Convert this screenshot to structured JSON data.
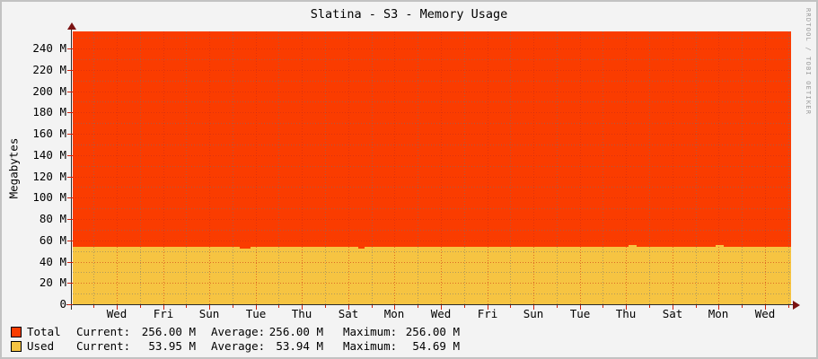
{
  "title": "Slatina - S3 - Memory Usage",
  "watermark": "RRDTOOL / TOBI OETIKER",
  "colors": {
    "total_area": "#FA3C00",
    "used_area": "#F6C442",
    "grid_minor": "#737373",
    "grid_major": "#CD2D14",
    "axis": "#2B2B2B",
    "arrow": "#7A1212",
    "tick": "#CC1F0A",
    "background": "#F3F3F3",
    "border": "#C2C2C2",
    "watermark_text": "#9A9A9A"
  },
  "y_axis": {
    "label": "Megabytes",
    "unit": "M",
    "ticks": [
      {
        "value": 240,
        "label": "240 M"
      },
      {
        "value": 220,
        "label": "220 M"
      },
      {
        "value": 200,
        "label": "200 M"
      },
      {
        "value": 180,
        "label": "180 M"
      },
      {
        "value": 160,
        "label": "160 M"
      },
      {
        "value": 140,
        "label": "140 M"
      },
      {
        "value": 120,
        "label": "120 M"
      },
      {
        "value": 100,
        "label": "100 M"
      },
      {
        "value": 80,
        "label": "80 M"
      },
      {
        "value": 60,
        "label": "60 M"
      },
      {
        "value": 40,
        "label": "40 M"
      },
      {
        "value": 20,
        "label": "20 M"
      },
      {
        "value": 0,
        "label": "0"
      }
    ]
  },
  "x_axis": {
    "labels": [
      "Wed",
      "Fri",
      "Sun",
      "Tue",
      "Thu",
      "Sat",
      "Mon",
      "Wed",
      "Fri",
      "Sun",
      "Tue",
      "Thu",
      "Sat",
      "Mon",
      "Wed"
    ]
  },
  "legend": {
    "columns": [
      "Current:",
      "Average:",
      "Maximum:"
    ],
    "rows": [
      {
        "name": "Total",
        "color": "#FA3C00",
        "current": "256.00 M",
        "average": "256.00 M",
        "maximum": "256.00 M"
      },
      {
        "name": "Used",
        "color": "#F6C442",
        "current": "53.95 M",
        "average": "53.94 M",
        "maximum": "54.69 M"
      }
    ]
  },
  "chart_data": {
    "type": "area",
    "title": "Slatina - S3 - Memory Usage",
    "xlabel": "",
    "ylabel": "Megabytes",
    "unit": "M",
    "ylim": [
      0,
      256
    ],
    "ytick_step": 20,
    "minor_ytick_step": 10,
    "grid": true,
    "legend_position": "bottom",
    "categories": [
      "Wed",
      "Fri",
      "Sun",
      "Tue",
      "Thu",
      "Sat",
      "Mon",
      "Wed",
      "Fri",
      "Sun",
      "Tue",
      "Thu",
      "Sat",
      "Mon",
      "Wed"
    ],
    "series": [
      {
        "name": "Total",
        "color": "#FA3C00",
        "values": [
          256,
          256,
          256,
          256,
          256,
          256,
          256,
          256,
          256,
          256,
          256,
          256,
          256,
          256,
          256
        ],
        "current": 256.0,
        "average": 256.0,
        "maximum": 256.0
      },
      {
        "name": "Used",
        "color": "#F6C442",
        "values": [
          53.94,
          53.94,
          53.9,
          53.6,
          53.94,
          53.6,
          53.94,
          53.94,
          53.94,
          53.94,
          53.94,
          54.69,
          53.94,
          54.5,
          53.94
        ],
        "current": 53.95,
        "average": 53.94,
        "maximum": 54.69
      }
    ],
    "annotations": [
      {
        "kind": "dip",
        "x": 186,
        "w": 12
      },
      {
        "kind": "dip",
        "x": 318,
        "w": 7
      },
      {
        "kind": "bump",
        "x": 619,
        "w": 9
      },
      {
        "kind": "bump",
        "x": 716,
        "w": 9
      }
    ]
  }
}
